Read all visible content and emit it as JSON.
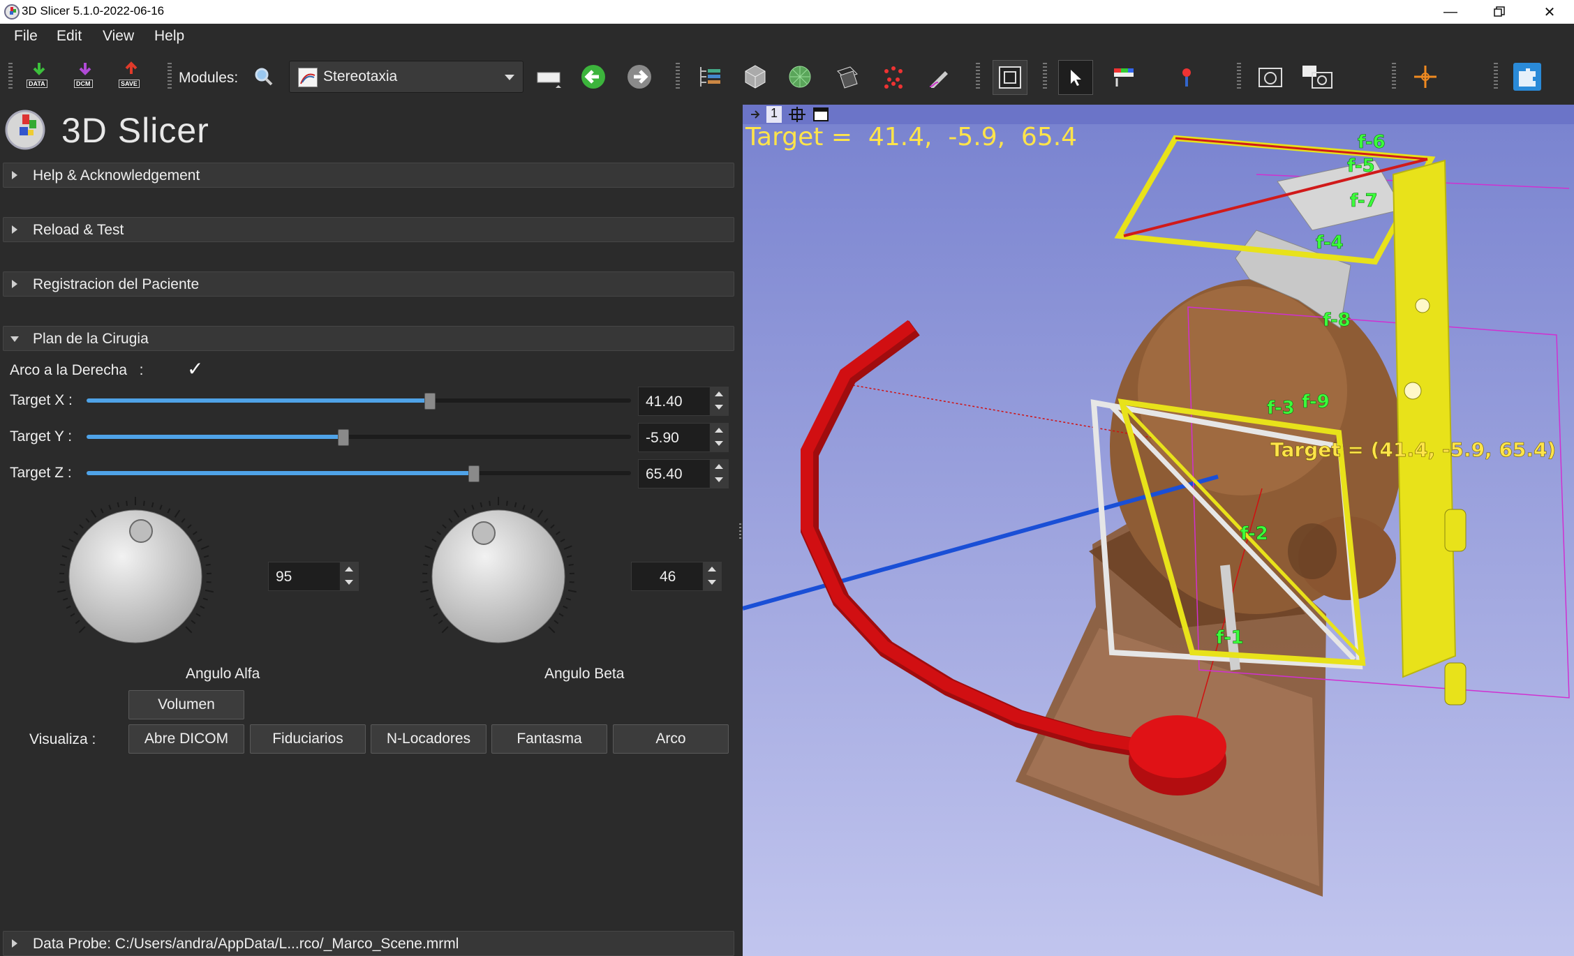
{
  "window": {
    "title": "3D Slicer 5.1.0-2022-06-16",
    "controls": [
      "minimize",
      "restore",
      "close"
    ]
  },
  "menubar": {
    "items": [
      {
        "label": "File"
      },
      {
        "label": "Edit"
      },
      {
        "label": "View"
      },
      {
        "label": "Help"
      }
    ]
  },
  "toolbar": {
    "data_label": "DATA",
    "dcm_label": "DCM",
    "save_label": "SAVE",
    "modules_label": "Modules:",
    "current_module": "Stereotaxia"
  },
  "panel": {
    "logo_text": "3D Slicer",
    "sections": {
      "help": "Help & Acknowledgement",
      "reload": "Reload & Test",
      "registration": "Registracion del Paciente",
      "plan": "Plan de la Cirugia"
    },
    "arco_derecha": {
      "label": "Arco a la Derecha   :",
      "checked": true,
      "check_glyph": "✓"
    },
    "target_x": {
      "label": "Target X :",
      "value": "41.40",
      "fraction": 0.63
    },
    "target_y": {
      "label": "Target Y :",
      "value": "-5.90",
      "fraction": 0.47
    },
    "target_z": {
      "label": "Target Z :",
      "value": "65.40",
      "fraction": 0.71
    },
    "alfa": {
      "label": "Angulo Alfa",
      "value": "95"
    },
    "beta": {
      "label": "Angulo Beta",
      "value": "46"
    },
    "volumen_button": "Volumen",
    "visualiza_label": "Visualiza :",
    "visualiza_buttons": [
      "Abre DICOM",
      "Fiduciarios",
      "N-Locadores",
      "Fantasma",
      "Arco"
    ],
    "data_probe": "Data Probe: C:/Users/andra/AppData/L...rco/_Marco_Scene.mrml"
  },
  "view3d": {
    "view_number": "1",
    "target_readout": "Target =  41.4,  -5.9,  65.4",
    "target_annotation": "Target = (41.4, -5.9, 65.4)",
    "fiducials": [
      "f-1",
      "f-2",
      "f-3",
      "f-4",
      "f-5",
      "f-6",
      "f-7",
      "f-8",
      "f-9"
    ],
    "colors": {
      "background_top": "#7a84d0",
      "frame": "#e8e21a",
      "arc": "#d10f12",
      "fiducial_text": "#3cff3c",
      "annotation_text": "#ffe44a",
      "trajectory": "#1a4fd6"
    }
  }
}
